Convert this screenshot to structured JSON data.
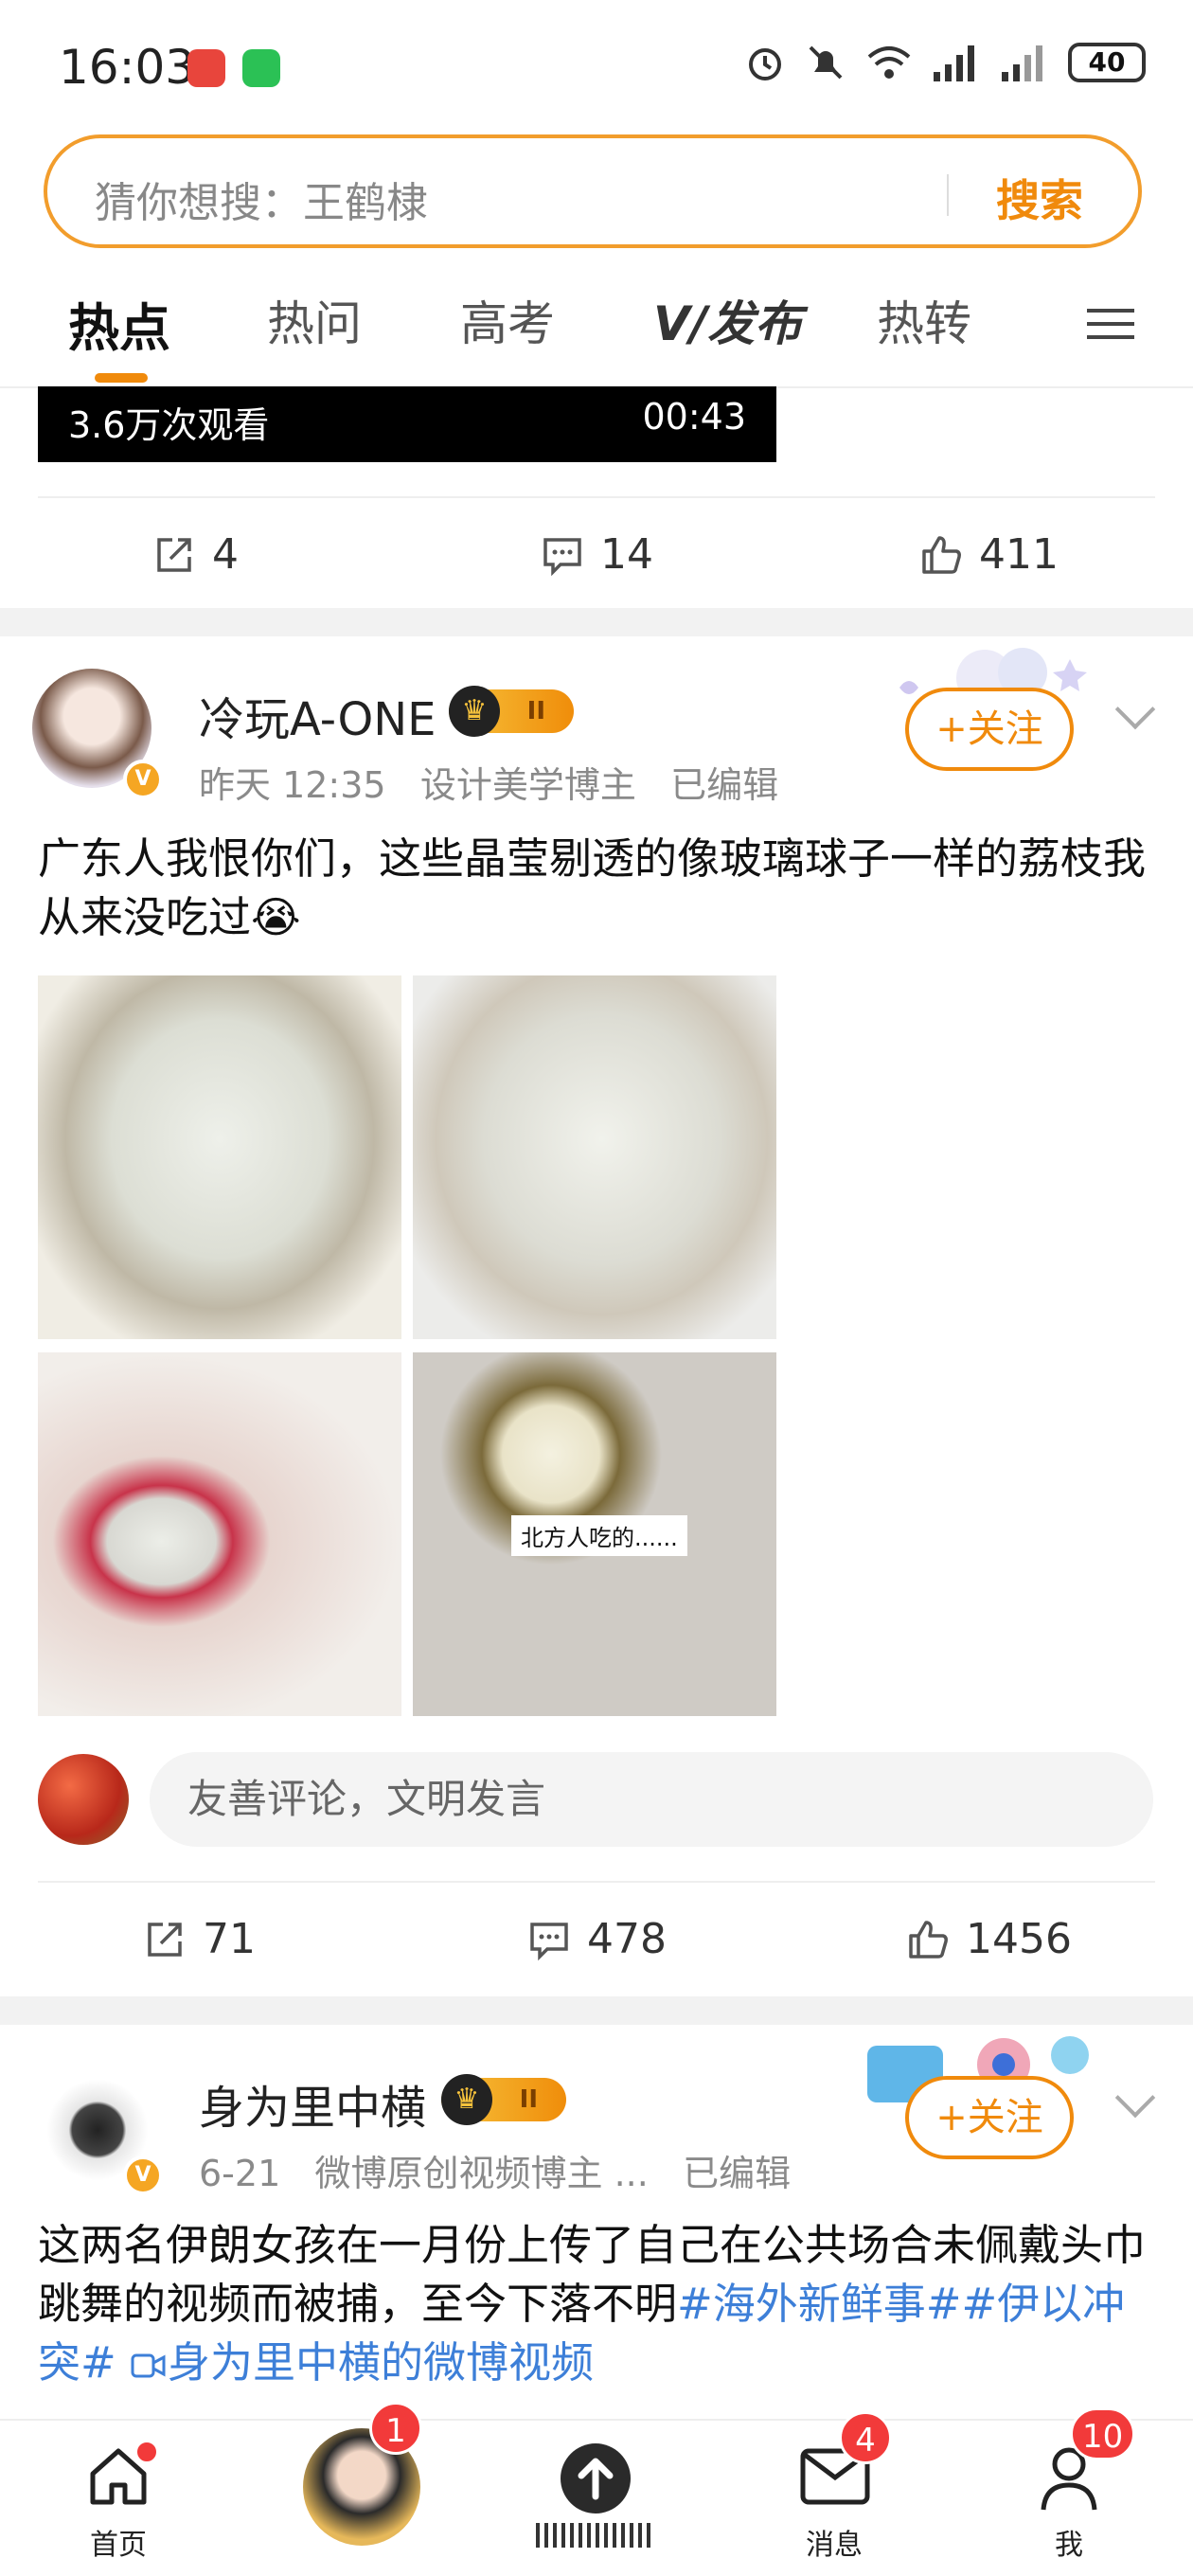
{
  "status_bar": {
    "time": "16:03",
    "battery": "40"
  },
  "search": {
    "placeholder": "猜你想搜：王鹤棣",
    "button": "搜索"
  },
  "tabs": [
    "热点",
    "热问",
    "高考",
    "发布",
    "热转"
  ],
  "video": {
    "views": "3.6万次观看",
    "duration": "00:43"
  },
  "post0_actions": {
    "reposts": "4",
    "comments": "14",
    "likes": "411"
  },
  "post1": {
    "username": "冷玩A-ONE",
    "level": "II",
    "time": "昨天 12:35",
    "source": "设计美学博主",
    "edited": "已编辑",
    "follow": "+关注",
    "text": "广东人我恨你们，这些晶莹剔透的像玻璃球子一样的荔枝我从来没吃过😭",
    "image_caption": "北方人吃的......",
    "comment_placeholder": "友善评论，文明发言",
    "reposts": "71",
    "comments": "478",
    "likes": "1456"
  },
  "post2": {
    "username": "身为里中横",
    "level": "II",
    "time": "6-21",
    "source": "微博原创视频博主 ...",
    "edited": "已编辑",
    "follow": "+关注",
    "text": "这两名伊朗女孩在一月份上传了自己在公共场合未佩戴头巾跳舞的视频而被捕，至今下落不明",
    "tag1": "#海外新鲜事#",
    "tag2": "#伊以冲突#",
    "video_link": "身为里中横的微博视频"
  },
  "bottom_nav": {
    "home": "首页",
    "messages": "消息",
    "me": "我",
    "badge_center": "1",
    "badge_messages": "4",
    "badge_me": "10"
  },
  "colors": {
    "accent": "#f08a0c",
    "link": "#3d7fd8",
    "badge": "#f23a3a"
  }
}
